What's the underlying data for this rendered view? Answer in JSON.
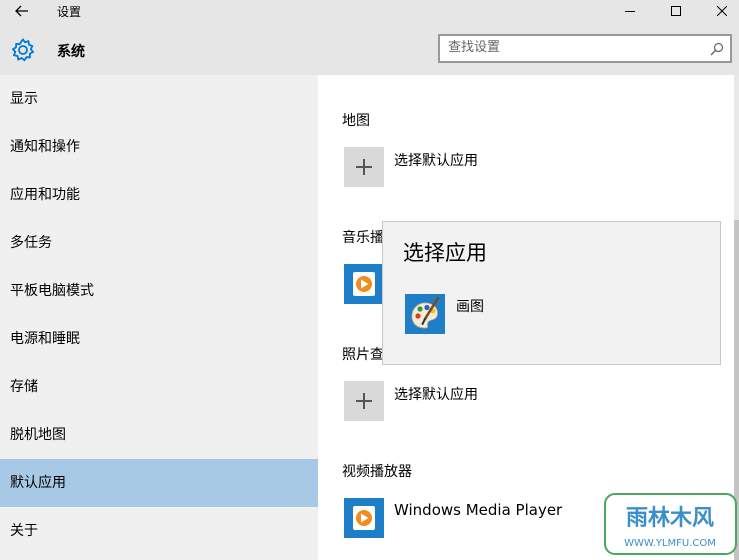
{
  "window": {
    "title": "设置"
  },
  "header": {
    "title": "系统",
    "icon": "gear-icon",
    "search": {
      "placeholder": "查找设置",
      "value": ""
    }
  },
  "sidebar": {
    "items": [
      {
        "label": "显示",
        "selected": false
      },
      {
        "label": "通知和操作",
        "selected": false
      },
      {
        "label": "应用和功能",
        "selected": false
      },
      {
        "label": "多任务",
        "selected": false
      },
      {
        "label": "平板电脑模式",
        "selected": false
      },
      {
        "label": "电源和睡眠",
        "selected": false
      },
      {
        "label": "存储",
        "selected": false
      },
      {
        "label": "脱机地图",
        "selected": false
      },
      {
        "label": "默认应用",
        "selected": true
      },
      {
        "label": "关于",
        "selected": false
      }
    ]
  },
  "main": {
    "sections": [
      {
        "label": "地图",
        "app": "选择默认应用",
        "icon": "plus-icon"
      },
      {
        "label": "音乐播",
        "app": "",
        "icon": "windows-media-player-icon"
      },
      {
        "label": "照片查",
        "app": "选择默认应用",
        "icon": "plus-icon"
      },
      {
        "label": "视频播放器",
        "app": "Windows Media Player",
        "icon": "windows-media-player-icon"
      }
    ]
  },
  "popup": {
    "title": "选择应用",
    "items": [
      {
        "label": "画图",
        "icon": "paint-icon"
      }
    ]
  },
  "watermark": {
    "text": "雨林木风",
    "url": "WWW.YLMFU.COM"
  },
  "colors": {
    "selected_nav": "#a7c9e6",
    "accent": "#0078d7",
    "sidebar_bg": "#f0f0f0",
    "header_bg": "#e6e6e6",
    "popup_bg": "#f2f2f2"
  }
}
